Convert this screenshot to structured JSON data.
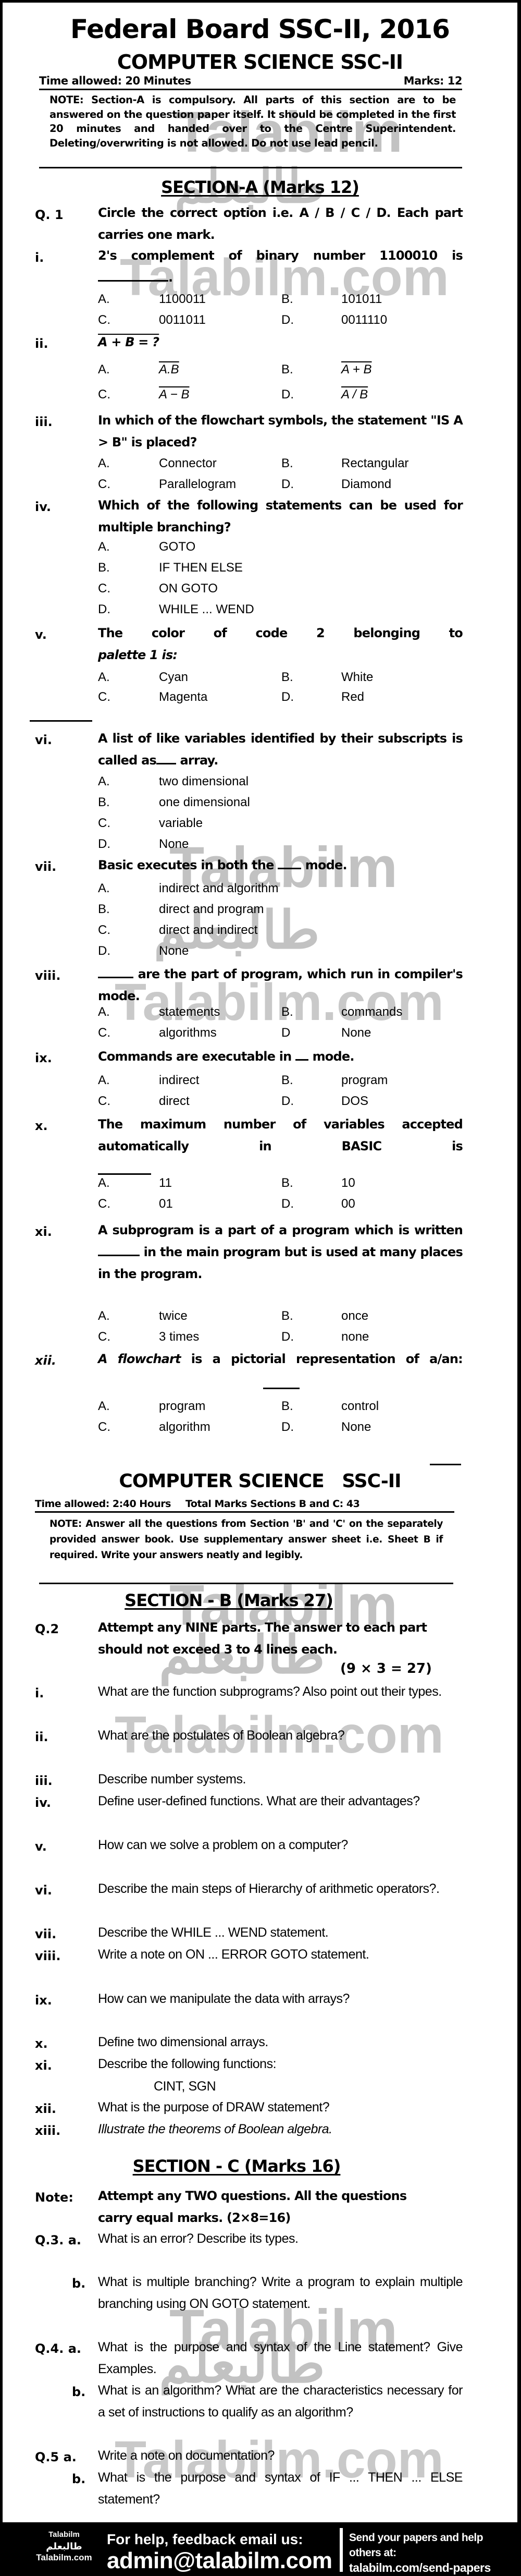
{
  "header": {
    "title": "Federal Board SSC-II, 2016",
    "subject": "COMPUTER SCIENCE SSC-II",
    "time_allowed": "Time allowed: 20 Minutes",
    "marks": "Marks: 12",
    "note": "NOTE: Section-A is compulsory. All parts of this section are to be answered on the question paper itself. It should be completed in the first 20 minutes and handed over to the Centre Superintendent. Deleting/overwriting is not allowed. Do not use lead pencil."
  },
  "section_a": {
    "heading": "SECTION-A (Marks 12)",
    "q_label": "Q. 1",
    "q_instruction": "Circle the correct option i.e. A / B / C / D. Each part carries one mark.",
    "questions": [
      {
        "num": "i.",
        "text": "2's complement of binary number 1100010 is",
        "options": [
          "1100011",
          "101011",
          "0011011",
          "0011110"
        ]
      },
      {
        "num": "ii.",
        "text": "A + B = ?",
        "options": [
          "A.B",
          "A + B",
          "A − B",
          "A / B"
        ]
      },
      {
        "num": "iii.",
        "text": "In which of the flowchart symbols, the statement \"IS A > B\" is placed?",
        "options": [
          "Connector",
          "Rectangular",
          "Parallelogram",
          "Diamond"
        ]
      },
      {
        "num": "iv.",
        "text": "Which of the following statements can be used for multiple branching?",
        "options": [
          "GOTO",
          "IF THEN ELSE",
          "ON GOTO",
          "WHILE ... WEND"
        ]
      },
      {
        "num": "v.",
        "text": "The color of code 2 belonging to",
        "text_italic": "palette 1 is:",
        "options": [
          "Cyan",
          "White",
          "Magenta",
          "Red"
        ]
      },
      {
        "num": "vi.",
        "text": "A list of like variables identified by their subscripts is called as",
        "text_after": "array.",
        "options": [
          "two dimensional",
          "one dimensional",
          "variable",
          "None"
        ]
      },
      {
        "num": "vii.",
        "text": "Basic executes in both the",
        "text_after": "mode.",
        "options": [
          "indirect and algorithm",
          "direct and program",
          "direct and indirect",
          "None"
        ]
      },
      {
        "num": "viii.",
        "text": "are the part of program, which run in compiler's mode.",
        "options": [
          "statements",
          "commands",
          "algorithms",
          "None"
        ]
      },
      {
        "num": "ix.",
        "text": "Commands are executable in",
        "text_after": "mode.",
        "options": [
          "indirect",
          "program",
          "direct",
          "DOS"
        ]
      },
      {
        "num": "x.",
        "text": "The maximum number of variables accepted automatically in BASIC is",
        "options": [
          "11",
          "10",
          "01",
          "00"
        ]
      },
      {
        "num": "xi.",
        "text": "A subprogram is a part of a program which is written",
        "text_after": "in the main program but is used at many places in the program.",
        "options": [
          "twice",
          "once",
          "3 times",
          "none"
        ]
      },
      {
        "num": "xii.",
        "text_italic": "A flowchart",
        "text": "is a pictorial representation of a/an:",
        "options": [
          "program",
          "control",
          "algorithm",
          "None"
        ]
      }
    ],
    "option_letters": [
      "A.",
      "B.",
      "C.",
      "D."
    ],
    "option_letters_alt": {
      "viii_d": "D"
    }
  },
  "part2_header": {
    "subject": "COMPUTER SCIENCE   SSC-II",
    "time_allowed": "Time allowed: 2:40 Hours",
    "total_marks": "Total Marks Sections B and C: 43",
    "note": "NOTE: Answer all the questions from Section 'B' and 'C' on the separately provided answer book. Use supplementary answer sheet i.e. Sheet B if required. Write your answers neatly and legibly."
  },
  "section_b": {
    "heading": "SECTION - B (Marks 27)",
    "q_label": "Q.2",
    "q_instruction": "Attempt any NINE parts. The answer to each part should not exceed 3 to 4 lines each.",
    "q_marks": "(9 × 3 = 27)",
    "questions": [
      {
        "num": "i.",
        "text": "What are the function subprograms? Also point out their types."
      },
      {
        "num": "ii.",
        "text": "What are the postulates of Boolean algebra?"
      },
      {
        "num": "iii.",
        "text": "Describe number systems."
      },
      {
        "num": "iv.",
        "text": "Define user-defined functions. What are their advantages?"
      },
      {
        "num": "v.",
        "text": "How can we solve a problem on a computer?"
      },
      {
        "num": "vi.",
        "text": "Describe the main steps of Hierarchy of arithmetic operators?."
      },
      {
        "num": "vii.",
        "text": "Describe the WHILE ... WEND statement."
      },
      {
        "num": "viii.",
        "text": "Write a note on ON ... ERROR GOTO statement."
      },
      {
        "num": "ix.",
        "text": "How can we manipulate the data with arrays?"
      },
      {
        "num": "x.",
        "text": "Define two dimensional arrays."
      },
      {
        "num": "xi.",
        "text": "Describe the following functions:",
        "sub": "CINT, SGN"
      },
      {
        "num": "xii.",
        "text": "What is the purpose of DRAW statement?"
      },
      {
        "num": "xiii.",
        "text": "Illustrate the theorems of Boolean algebra."
      }
    ]
  },
  "section_c": {
    "heading": "SECTION - C (Marks 16)",
    "note_label": "Note:",
    "note": "Attempt any TWO questions. All the questions carry equal marks. (2×8=16)",
    "questions": [
      {
        "num": "Q.3. a.",
        "text": "What is an error? Describe its types."
      },
      {
        "num": "b.",
        "text": "What is multiple branching? Write a program to explain multiple branching using ON GOTO statement."
      },
      {
        "num": "Q.4. a.",
        "text": "What is the purpose and syntax of the Line statement? Give Examples."
      },
      {
        "num": "b.",
        "text": "What is an algorithm? What are the characteristics necessary for a set of instructions to qualify as an algorithm?"
      },
      {
        "num": "Q.5 a.",
        "text": "Write a note on documentation?"
      },
      {
        "num": "b.",
        "text": "What is the purpose and syntax of IF ... THEN ... ELSE statement?"
      }
    ]
  },
  "watermark": {
    "latin": "Talabilm",
    "domain": "Talabilm.com",
    "arabic": "طالبعلم"
  },
  "footer": {
    "brand_top": "Talabilm",
    "brand_arabic": "طالبعلم",
    "brand_bottom": "Talabilm.com",
    "help_label": "For help, feedback email us:",
    "email": "admin@talabilm.com",
    "send_label": "Send your papers and help others at:",
    "send_url": "talabilm.com/send-papers"
  },
  "colors": {
    "page": "#ffffff",
    "border": "#000000",
    "text": "#000000",
    "watermark": "#b8b8b8",
    "footer_bg": "#000000",
    "footer_text": "#ffffff"
  }
}
